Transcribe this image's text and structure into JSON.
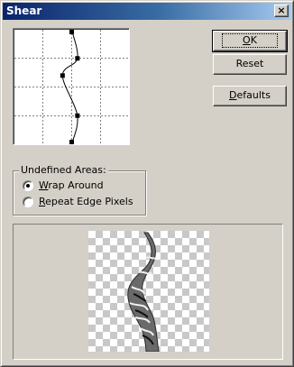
{
  "window": {
    "title": "Shear",
    "close_glyph": "×"
  },
  "buttons": {
    "ok": "OK",
    "ok_underline": "O",
    "ok_rest": "K",
    "reset": "Reset",
    "defaults": "Defaults",
    "defaults_underline": "D",
    "defaults_rest": "efaults"
  },
  "curve": {
    "points": [
      [
        0.5,
        0.0
      ],
      [
        0.55,
        0.25
      ],
      [
        0.42,
        0.4
      ],
      [
        0.55,
        0.75
      ],
      [
        0.5,
        1.0
      ]
    ]
  },
  "undefined_areas": {
    "label": "Undefined Areas:",
    "options": [
      {
        "underline": "W",
        "rest": "rap Around",
        "selected": true
      },
      {
        "underline": "R",
        "rest": "epeat Edge Pixels",
        "selected": false
      }
    ]
  },
  "preview": {
    "icon": "distorted-image-preview"
  },
  "colors": {
    "face": "#d4d0c8",
    "title_start": "#0a246a",
    "title_end": "#a6caf0"
  }
}
